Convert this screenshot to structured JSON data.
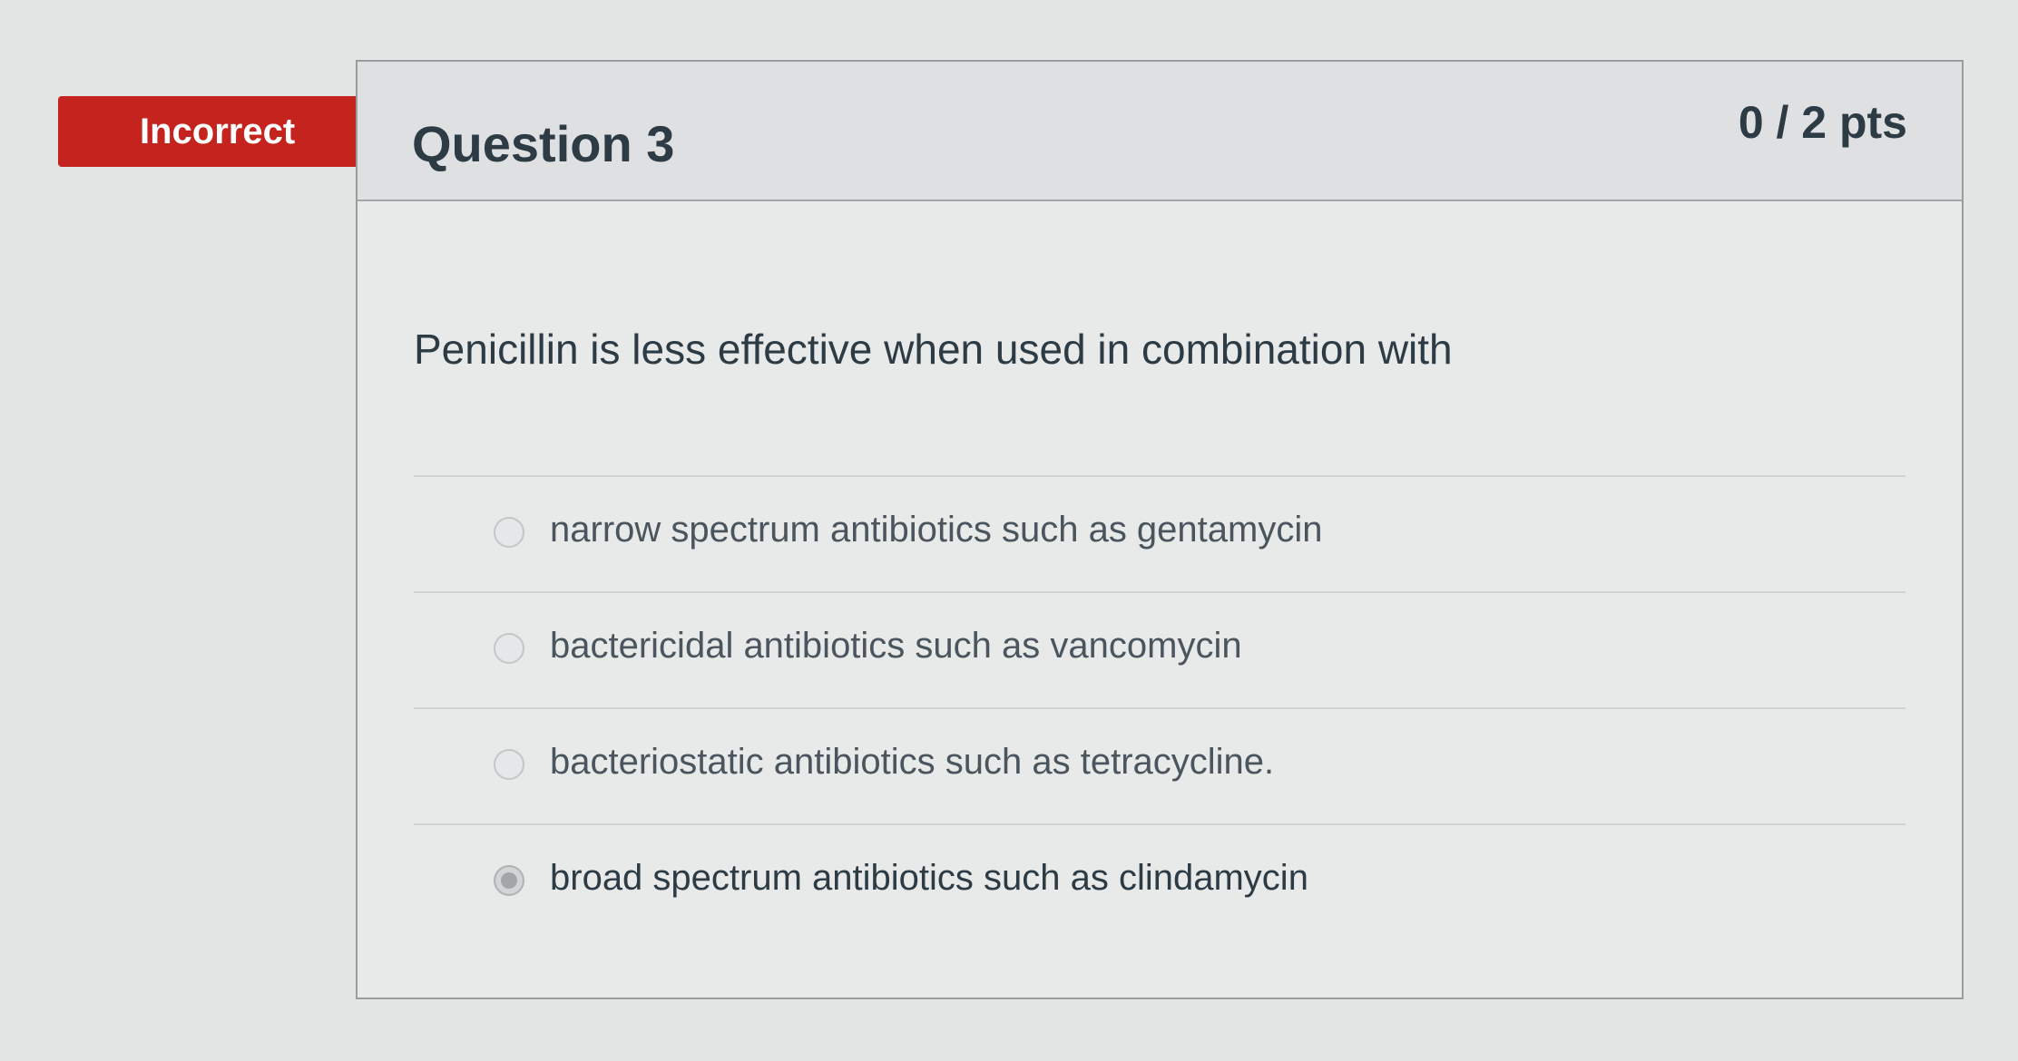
{
  "badge": {
    "label": "Incorrect",
    "color": "#c5231d"
  },
  "question": {
    "title": "Question 3",
    "points": "0 / 2 pts",
    "text": "Penicillin is less effective when used in combination with",
    "answers": [
      {
        "label": "narrow spectrum antibiotics such as gentamycin",
        "selected": false
      },
      {
        "label": "bactericidal antibiotics such as vancomycin",
        "selected": false
      },
      {
        "label": "bacteriostatic antibiotics such as tetracycline.",
        "selected": false
      },
      {
        "label": "broad spectrum antibiotics such as clindamycin",
        "selected": true
      }
    ]
  }
}
